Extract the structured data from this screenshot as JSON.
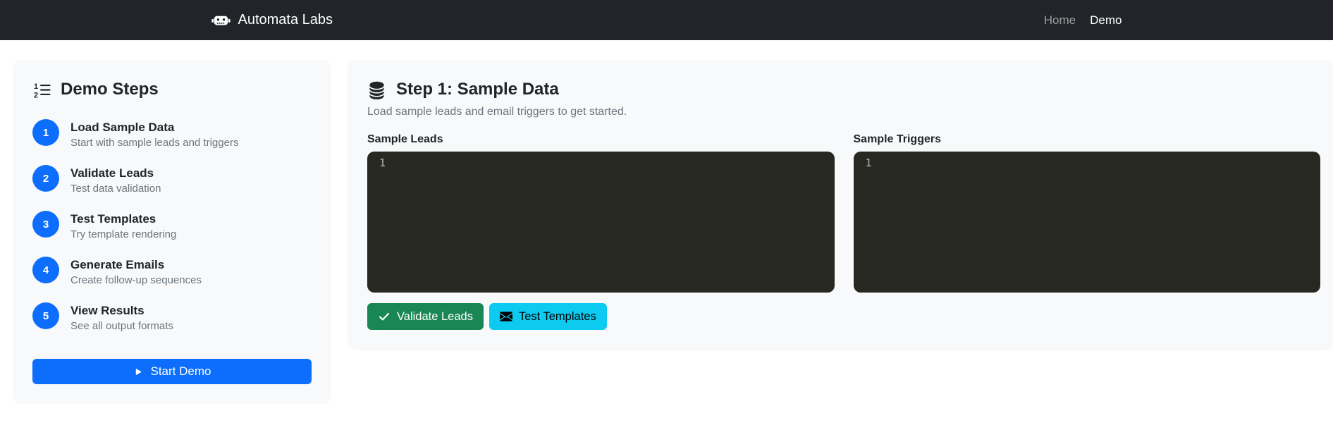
{
  "navbar": {
    "brand": "Automata Labs",
    "links": [
      {
        "label": "Home",
        "active": false
      },
      {
        "label": "Demo",
        "active": true
      }
    ]
  },
  "sidebar": {
    "title": "Demo Steps",
    "steps": [
      {
        "num": "1",
        "title": "Load Sample Data",
        "desc": "Start with sample leads and triggers"
      },
      {
        "num": "2",
        "title": "Validate Leads",
        "desc": "Test data validation"
      },
      {
        "num": "3",
        "title": "Test Templates",
        "desc": "Try template rendering"
      },
      {
        "num": "4",
        "title": "Generate Emails",
        "desc": "Create follow-up sequences"
      },
      {
        "num": "5",
        "title": "View Results",
        "desc": "See all output formats"
      }
    ],
    "start_button": "Start Demo"
  },
  "main": {
    "title": "Step 1: Sample Data",
    "subtitle": "Load sample leads and email triggers to get started.",
    "editors": [
      {
        "label": "Sample Leads",
        "line_number": "1"
      },
      {
        "label": "Sample Triggers",
        "line_number": "1"
      }
    ],
    "buttons": [
      {
        "label": "Validate Leads",
        "icon": "check-icon",
        "style": "success"
      },
      {
        "label": "Test Templates",
        "icon": "envelope-icon",
        "style": "info"
      }
    ]
  },
  "colors": {
    "navbar_bg": "#212529",
    "card_bg": "#f8f9fa",
    "primary": "#0d6efd",
    "success": "#198754",
    "info": "#0dcaf0",
    "editor_bg": "#272822",
    "muted_text": "#6c757d"
  }
}
